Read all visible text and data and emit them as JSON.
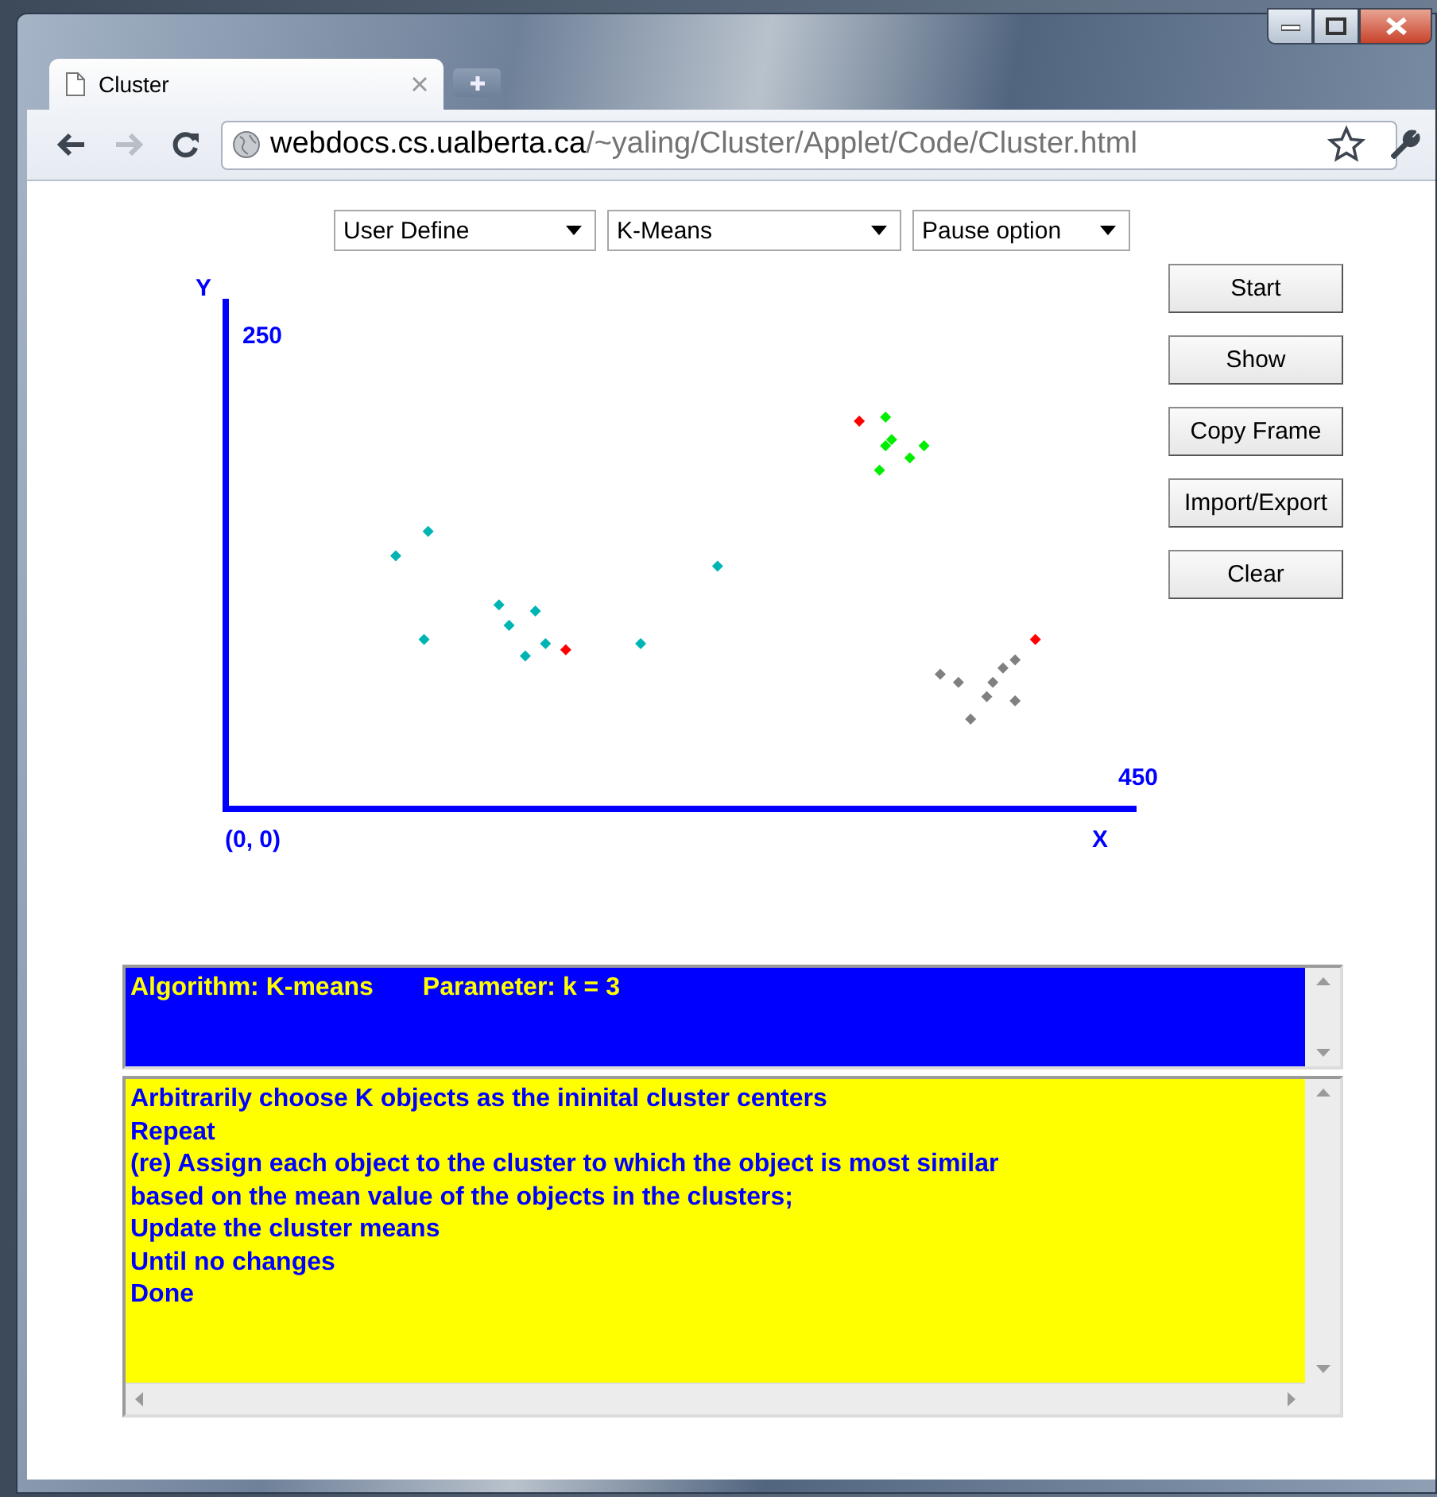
{
  "browser": {
    "tab": {
      "title": "Cluster",
      "selected": true
    },
    "address": {
      "host": "webdocs.cs.ualberta.ca",
      "path": "/~yaling/Cluster/Applet/Code/Cluster.html"
    }
  },
  "dropdowns": [
    {
      "value": "User Define"
    },
    {
      "value": "K-Means"
    },
    {
      "value": "Pause option"
    }
  ],
  "buttons": [
    "Start",
    "Show",
    "Copy Frame",
    "Import/Export",
    "Clear"
  ],
  "plot": {
    "y_axis_label": "Y",
    "y_max_label": "250",
    "x_max_label": "450",
    "origin_label": "(0, 0)",
    "x_axis_label": "X"
  },
  "info_panel": {
    "algorithm": "Algorithm: K-means",
    "parameter": "Parameter: k = 3"
  },
  "steps_panel": {
    "lines": [
      "Arbitrarily choose K objects as the ininital cluster centers",
      "Repeat",
      "(re) Assign each object to the cluster to which the object is most similar",
      "based on the mean value of the objects in the clusters;",
      "Update the cluster means",
      "Until no changes",
      "Done"
    ]
  }
}
